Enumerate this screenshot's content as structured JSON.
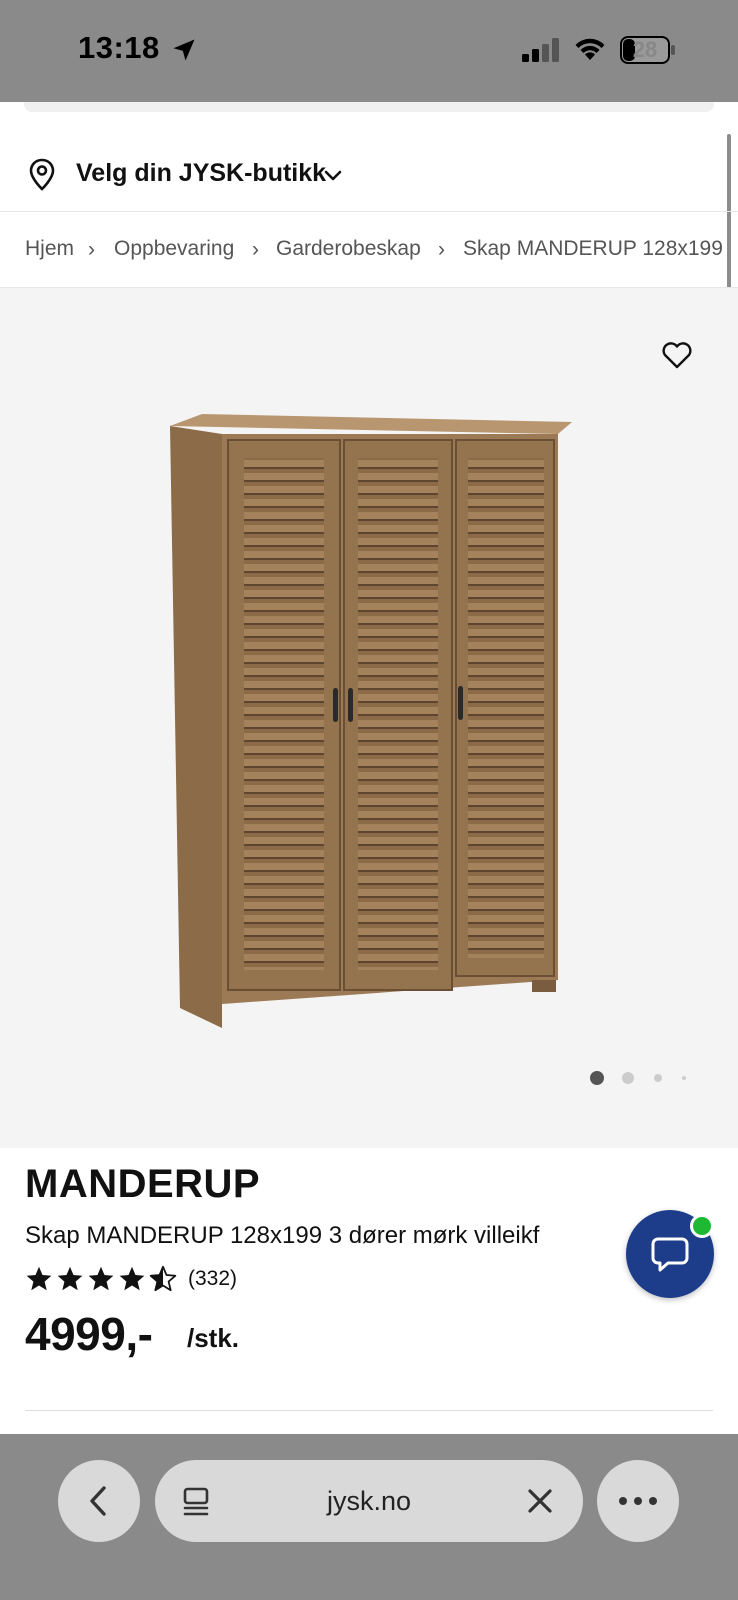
{
  "status_bar": {
    "time": "13:18",
    "battery": "28"
  },
  "store_selector": {
    "label": "Velg din JYSK-butikk"
  },
  "breadcrumb": {
    "items": [
      "Hjem",
      "Oppbevaring",
      "Garderobeskap",
      "Skap MANDERUP 128x199"
    ],
    "separator": "›"
  },
  "gallery": {
    "image_count": 4,
    "active_index": 0
  },
  "product": {
    "name": "MANDERUP",
    "description": "Skap MANDERUP 128x199 3 dører mørk villeikf",
    "rating": 4.5,
    "review_count": "(332)",
    "price": "4999,-",
    "price_unit": "/stk."
  },
  "browser": {
    "url": "jysk.no"
  },
  "colors": {
    "chat_button": "#1d3c8a",
    "chat_online": "#1fb832",
    "gallery_bg": "#f4f4f4",
    "chrome_bg": "#8a8a8a"
  }
}
